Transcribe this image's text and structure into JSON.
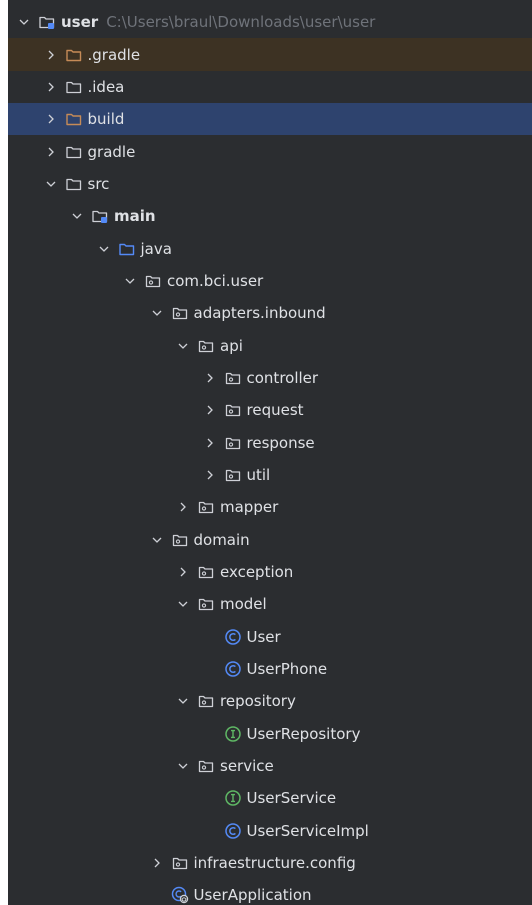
{
  "project_tree": {
    "root": {
      "label": "user",
      "path": "C:\\Users\\braul\\Downloads\\user\\user"
    },
    "nodes": [
      {
        "label": ".gradle",
        "level": 1,
        "state": "collapsed",
        "icon": "folder-orange-icon",
        "highlight": "modified"
      },
      {
        "label": ".idea",
        "level": 1,
        "state": "collapsed",
        "icon": "folder-icon"
      },
      {
        "label": "build",
        "level": 1,
        "state": "collapsed",
        "icon": "folder-orange-icon",
        "highlight": "selected"
      },
      {
        "label": "gradle",
        "level": 1,
        "state": "collapsed",
        "icon": "folder-icon"
      },
      {
        "label": "src",
        "level": 1,
        "state": "expanded",
        "icon": "folder-icon"
      },
      {
        "label": "main",
        "level": 2,
        "state": "expanded",
        "icon": "module-folder-icon",
        "bold": true
      },
      {
        "label": "java",
        "level": 3,
        "state": "expanded",
        "icon": "source-folder-icon"
      },
      {
        "label": "com.bci.user",
        "level": 4,
        "state": "expanded",
        "icon": "package-icon"
      },
      {
        "label": "adapters.inbound",
        "level": 5,
        "state": "expanded",
        "icon": "package-icon"
      },
      {
        "label": "api",
        "level": 6,
        "state": "expanded",
        "icon": "package-icon"
      },
      {
        "label": "controller",
        "level": 7,
        "state": "collapsed",
        "icon": "package-icon"
      },
      {
        "label": "request",
        "level": 7,
        "state": "collapsed",
        "icon": "package-icon"
      },
      {
        "label": "response",
        "level": 7,
        "state": "collapsed",
        "icon": "package-icon"
      },
      {
        "label": "util",
        "level": 7,
        "state": "collapsed",
        "icon": "package-icon"
      },
      {
        "label": "mapper",
        "level": 6,
        "state": "collapsed",
        "icon": "package-icon"
      },
      {
        "label": "domain",
        "level": 5,
        "state": "expanded",
        "icon": "package-icon"
      },
      {
        "label": "exception",
        "level": 6,
        "state": "collapsed",
        "icon": "package-icon"
      },
      {
        "label": "model",
        "level": 6,
        "state": "expanded",
        "icon": "package-icon"
      },
      {
        "label": "User",
        "level": 7,
        "state": "leaf",
        "icon": "class-icon"
      },
      {
        "label": "UserPhone",
        "level": 7,
        "state": "leaf",
        "icon": "class-icon"
      },
      {
        "label": "repository",
        "level": 6,
        "state": "expanded",
        "icon": "package-icon"
      },
      {
        "label": "UserRepository",
        "level": 7,
        "state": "leaf",
        "icon": "interface-icon"
      },
      {
        "label": "service",
        "level": 6,
        "state": "expanded",
        "icon": "package-icon"
      },
      {
        "label": "UserService",
        "level": 7,
        "state": "leaf",
        "icon": "interface-icon"
      },
      {
        "label": "UserServiceImpl",
        "level": 7,
        "state": "leaf",
        "icon": "class-icon"
      },
      {
        "label": "infraestructure.config",
        "level": 5,
        "state": "collapsed",
        "icon": "package-icon"
      },
      {
        "label": "UserApplication",
        "level": 5,
        "state": "leaf",
        "icon": "spring-boot-class-icon"
      }
    ]
  },
  "colors": {
    "background": "#2b2d30",
    "text": "#dfe1e5",
    "muted_text": "#6f737a",
    "modified_row": "#3d3223",
    "selected_row": "#2e436e",
    "folder_orange": "#c68b57",
    "folder_blue": "#548af7",
    "class_blue": "#548af7",
    "interface_green": "#5fb865"
  }
}
